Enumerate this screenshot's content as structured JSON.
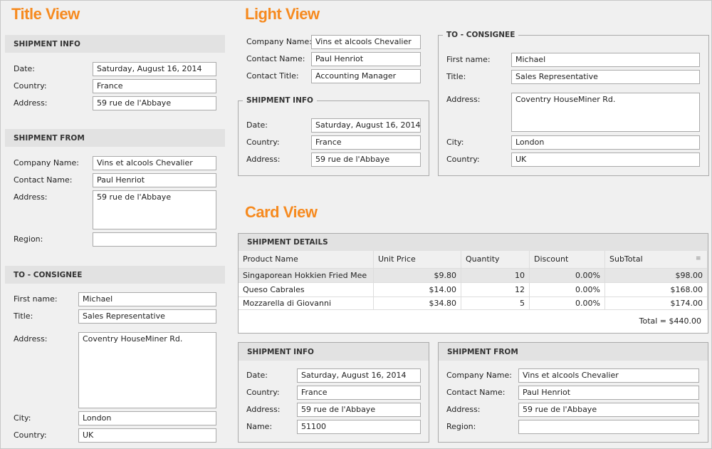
{
  "views": {
    "title_view": "Title View",
    "light_view": "Light View",
    "card_view": "Card View"
  },
  "title_view": {
    "shipment_info": {
      "header": "SHIPMENT INFO",
      "fields": [
        {
          "label": "Date:",
          "value": "Saturday, August 16, 2014"
        },
        {
          "label": "Country:",
          "value": "France"
        },
        {
          "label": "Address:",
          "value": "59 rue de l'Abbaye"
        }
      ]
    },
    "shipment_from": {
      "header": "SHIPMENT FROM",
      "fields": [
        {
          "label": "Company Name:",
          "value": "Vins et alcools Chevalier"
        },
        {
          "label": "Contact Name:",
          "value": "Paul Henriot"
        },
        {
          "label": "Address:",
          "value": "59 rue de l'Abbaye"
        },
        {
          "label": "Region:",
          "value": ""
        }
      ]
    },
    "to_consignee": {
      "header": "TO - CONSIGNEE",
      "fields": [
        {
          "label": "First name:",
          "value": "Michael"
        },
        {
          "label": "Title:",
          "value": "Sales Representative"
        },
        {
          "label": "Address:",
          "value": "Coventry HouseMiner Rd."
        },
        {
          "label": "City:",
          "value": "London"
        },
        {
          "label": "Country:",
          "value": "UK"
        }
      ]
    }
  },
  "light_view": {
    "company": {
      "fields": [
        {
          "label": "Company Name:",
          "value": "Vins et alcools Chevalier"
        },
        {
          "label": "Contact Name:",
          "value": "Paul Henriot"
        },
        {
          "label": "Contact Title:",
          "value": "Accounting Manager"
        }
      ]
    },
    "shipment_info": {
      "header": "SHIPMENT INFO",
      "fields": [
        {
          "label": "Date:",
          "value": "Saturday, August 16, 2014"
        },
        {
          "label": "Country:",
          "value": "France"
        },
        {
          "label": "Address:",
          "value": "59 rue de l'Abbaye"
        }
      ]
    },
    "to_consignee": {
      "header": "TO - CONSIGNEE",
      "fields": [
        {
          "label": "First name:",
          "value": "Michael"
        },
        {
          "label": "Title:",
          "value": "Sales Representative"
        },
        {
          "label": "Address:",
          "value": "Coventry HouseMiner Rd."
        },
        {
          "label": "City:",
          "value": "London"
        },
        {
          "label": "Country:",
          "value": "UK"
        }
      ]
    }
  },
  "card_view": {
    "shipment_details": {
      "header": "SHIPMENT DETAILS",
      "columns": [
        "Product Name",
        "Unit Price",
        "Quantity",
        "Discount",
        "SubTotal"
      ],
      "rows": [
        [
          "Singaporean Hokkien Fried Mee",
          "$9.80",
          "10",
          "0.00%",
          "$98.00"
        ],
        [
          "Queso Cabrales",
          "$14.00",
          "12",
          "0.00%",
          "$168.00"
        ],
        [
          "Mozzarella di Giovanni",
          "$34.80",
          "5",
          "0.00%",
          "$174.00"
        ]
      ],
      "total": "Total = $440.00"
    },
    "shipment_info": {
      "header": "SHIPMENT INFO",
      "fields": [
        {
          "label": "Date:",
          "value": "Saturday, August 16, 2014"
        },
        {
          "label": "Country:",
          "value": "France"
        },
        {
          "label": "Address:",
          "value": "59 rue de l'Abbaye"
        },
        {
          "label": "Name:",
          "value": "51100"
        }
      ]
    },
    "shipment_from": {
      "header": "SHIPMENT FROM",
      "fields": [
        {
          "label": "Company Name:",
          "value": "Vins et alcools Chevalier"
        },
        {
          "label": "Contact Name:",
          "value": "Paul Henriot"
        },
        {
          "label": "Address:",
          "value": "59 rue de l'Abbaye"
        },
        {
          "label": "Region:",
          "value": ""
        }
      ]
    }
  }
}
